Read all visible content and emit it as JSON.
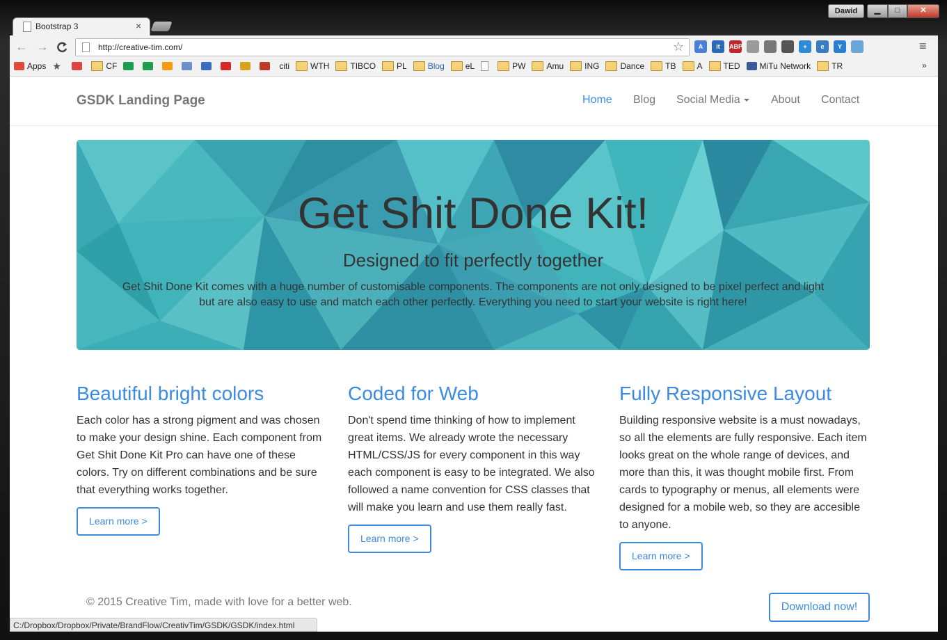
{
  "window": {
    "user_name": "Dawid",
    "min_label": "▁",
    "max_label": "□",
    "close_label": "✕"
  },
  "tab": {
    "title": "Bootstrap 3",
    "close": "×"
  },
  "toolbar": {
    "url": "http://creative-tim.com/",
    "back": "←",
    "forward": "→",
    "reload": "C",
    "star": "☆",
    "menu": "≡"
  },
  "extensions": [
    {
      "name": "translate-icon",
      "text": "A",
      "color": "#4a7fd6"
    },
    {
      "name": "it-icon",
      "text": "it",
      "color": "#2a6ab8"
    },
    {
      "name": "adblock-icon",
      "text": "ABP",
      "color": "#c0272d"
    },
    {
      "name": "shield-icon",
      "text": "",
      "color": "#9a9a9a"
    },
    {
      "name": "cast-icon",
      "text": "",
      "color": "#777777"
    },
    {
      "name": "pocket-icon",
      "text": "",
      "color": "#555555"
    },
    {
      "name": "plus-icon",
      "text": "+",
      "color": "#2d8ad6"
    },
    {
      "name": "ie-icon",
      "text": "e",
      "color": "#3a7cc0"
    },
    {
      "name": "y-icon",
      "text": "Y",
      "color": "#2a7fd0"
    },
    {
      "name": "camera-icon",
      "text": "",
      "color": "#6aa6d8"
    }
  ],
  "bookmarks": [
    {
      "label": "Apps",
      "icon": "apps",
      "color": "#e04a3a"
    },
    {
      "label": "",
      "icon": "star",
      "color": "#555555"
    },
    {
      "label": "",
      "icon": "gmail",
      "color": "#d44"
    },
    {
      "label": "CF",
      "icon": "folder",
      "color": ""
    },
    {
      "label": "",
      "icon": "sheet",
      "color": "#1e9d4f"
    },
    {
      "label": "",
      "icon": "sheet",
      "color": "#1e9d4f"
    },
    {
      "label": "",
      "icon": "chart",
      "color": "#f39c12"
    },
    {
      "label": "",
      "icon": "calc",
      "color": "#6b8fc8"
    },
    {
      "label": "",
      "icon": "contact",
      "color": "#3a6cbf"
    },
    {
      "label": "",
      "icon": "circle",
      "color": "#d42a2a"
    },
    {
      "label": "",
      "icon": "grid",
      "color": "#d8a21c"
    },
    {
      "label": "",
      "icon": "m",
      "color": "#c03a2a"
    },
    {
      "label": "citi",
      "icon": "none",
      "color": ""
    },
    {
      "label": "WTH",
      "icon": "folder",
      "color": ""
    },
    {
      "label": "TIBCO",
      "icon": "folder",
      "color": ""
    },
    {
      "label": "PL",
      "icon": "folder",
      "color": ""
    },
    {
      "label": "Blog",
      "icon": "folder",
      "color": ""
    },
    {
      "label": "eL",
      "icon": "folder",
      "color": ""
    },
    {
      "label": "",
      "icon": "page",
      "color": ""
    },
    {
      "label": "PW",
      "icon": "folder",
      "color": ""
    },
    {
      "label": "Amu",
      "icon": "folder",
      "color": ""
    },
    {
      "label": "ING",
      "icon": "folder",
      "color": ""
    },
    {
      "label": "Dance",
      "icon": "folder",
      "color": ""
    },
    {
      "label": "TB",
      "icon": "folder",
      "color": ""
    },
    {
      "label": "A",
      "icon": "folder",
      "color": ""
    },
    {
      "label": "TED",
      "icon": "folder",
      "color": ""
    },
    {
      "label": "MiTu Network",
      "icon": "facebook",
      "color": "#3b5998"
    },
    {
      "label": "TR",
      "icon": "folder",
      "color": ""
    }
  ],
  "bookmarks_more": "»",
  "site": {
    "brand": "GSDK Landing Page",
    "nav": [
      {
        "label": "Home",
        "active": true
      },
      {
        "label": "Blog",
        "active": false
      },
      {
        "label": "Social Media",
        "active": false,
        "dropdown": true
      },
      {
        "label": "About",
        "active": false
      },
      {
        "label": "Contact",
        "active": false
      }
    ],
    "hero": {
      "title": "Get Shit Done Kit!",
      "subtitle": "Designed to fit perfectly together",
      "description": "Get Shit Done Kit comes with a huge number of customisable components. The components are not only designed to be pixel perfect and light but are also easy to use and match each other perfectly. Everything you need to start your website is right here!"
    },
    "features": [
      {
        "title": "Beautiful bright colors",
        "text": "Each color has a strong pigment and was chosen to make your design shine. Each component from Get Shit Done Kit Pro can have one of these colors. Try on different combinations and be sure that everything works together.",
        "button": "Learn more >"
      },
      {
        "title": "Coded for Web",
        "text": "Don't spend time thinking of how to implement great items. We already wrote the necessary HTML/CSS/JS for every component in this way each component is easy to be integrated. We also followed a name convention for CSS classes that will make you learn and use them really fast.",
        "button": "Learn more >"
      },
      {
        "title": "Fully Responsive Layout",
        "text": "Building responsive website is a must nowadays, so all the elements are fully responsive. Each item looks great on the whole range of devices, and more than this, it was thought mobile first. From cards to typography or menus, all elements were designed for a mobile web, so they are accesible to anyone.",
        "button": "Learn more >"
      }
    ],
    "footer": "© 2015 Creative Tim, made with love for a better web.",
    "download": "Download now!"
  },
  "status_bar": "C:/Dropbox/Dropbox/Private/BrandFlow/CreativTim/GSDK/GSDK/index.html",
  "colors": {
    "accent": "#3b8be0",
    "hero_base": "#3fb5bd",
    "text": "#333333",
    "muted": "#777777"
  }
}
